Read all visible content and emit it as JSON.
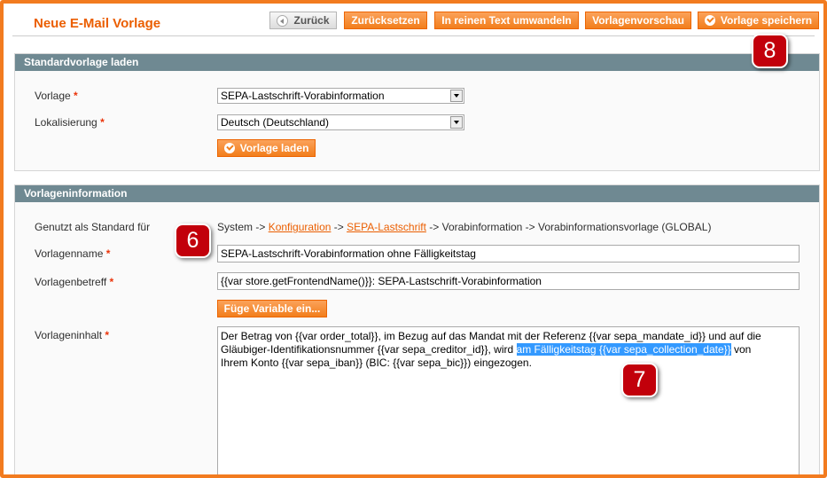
{
  "page": {
    "title": "Neue E-Mail Vorlage"
  },
  "toolbar": {
    "back": "Zurück",
    "reset": "Zurücksetzen",
    "convert": "In reinen Text umwandeln",
    "preview": "Vorlagenvorschau",
    "save": "Vorlage speichern"
  },
  "load_section": {
    "header": "Standardvorlage laden",
    "template_label": "Vorlage",
    "template_value": "SEPA-Lastschrift-Vorabinformation",
    "locale_label": "Lokalisierung",
    "locale_value": "Deutsch (Deutschland)",
    "load_button": "Vorlage laden"
  },
  "info_section": {
    "header": "Vorlageninformation",
    "used_default_label": "Genutzt als Standard für",
    "path": {
      "p1": "System ->",
      "link1": "Konfiguration",
      "p2": "->",
      "link2": "SEPA-Lastschrift",
      "p3": "-> Vorabinformation -> Vorabinformationsvorlage  (GLOBAL)"
    },
    "name_label": "Vorlagenname",
    "name_value": "SEPA-Lastschrift-Vorabinformation ohne Fälligkeitstag",
    "subject_label": "Vorlagenbetreff",
    "subject_value": "{{var store.getFrontendName()}}: SEPA-Lastschrift-Vorabinformation",
    "insert_variable": "Füge Variable ein...",
    "content_label": "Vorlageninhalt",
    "content": {
      "line1": "Der Betrag von {{var order_total}}, im Bezug auf das Mandat mit der Referenz {{var sepa_mandate_id}} und auf die",
      "line2_a": "Gläubiger-Identifikationsnummer {{var sepa_creditor_id}}, wird ",
      "line2_highlight": "am Fälligkeitstag {{var sepa_collection_date}}",
      "line2_b": " von",
      "line3": "Ihrem Konto {{var sepa_iban}} (BIC: {{var sepa_bic}}) eingezogen."
    }
  },
  "annotations": {
    "six": "6",
    "seven": "7",
    "eight": "8"
  },
  "colors": {
    "accent": "#f27b1f",
    "section_header": "#6f8992",
    "badge": "#c2000b",
    "selection": "#3399ff"
  }
}
